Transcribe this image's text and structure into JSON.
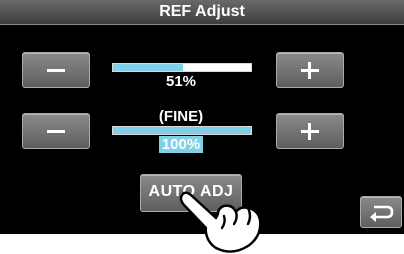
{
  "window": {
    "title": "REF Adjust"
  },
  "coarse": {
    "value_text": "51%",
    "level": 0.51,
    "minus_label": "−",
    "plus_label": "+"
  },
  "fine": {
    "mode_label": "(FINE)",
    "value_text": "100%",
    "level": 1.0,
    "minus_label": "−",
    "plus_label": "+"
  },
  "auto_adjust": {
    "label": "AUTO ADJ"
  },
  "back": {
    "icon": "return-arrow-icon"
  },
  "colors": {
    "accent": "#7fd0e8",
    "screen_bg": "#000000",
    "button_bg": "#6e6e6e"
  }
}
